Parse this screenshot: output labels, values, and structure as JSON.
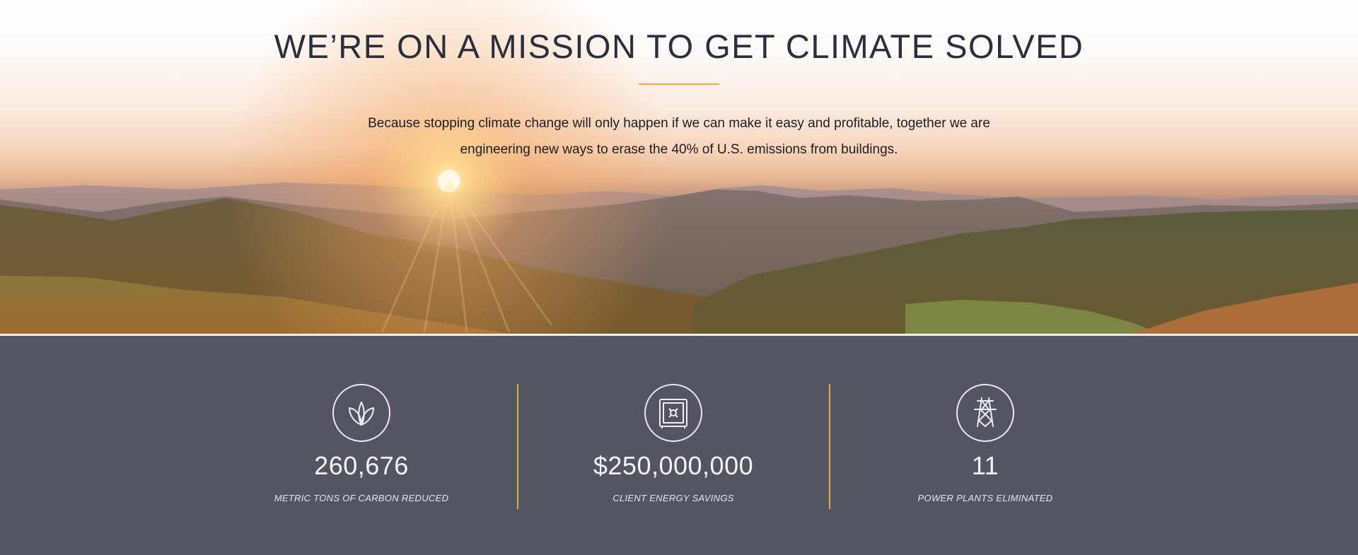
{
  "hero": {
    "title": "WE’RE ON A MISSION TO GET CLIMATE SOLVED",
    "subtitle_line1": "Because stopping climate change will only happen if we can make it easy and profitable, together we are",
    "subtitle_line2": "engineering new ways to erase the 40% of U.S. emissions from buildings.",
    "divider_color": "#e8ad3a"
  },
  "stats": {
    "background": "#535662",
    "items": [
      {
        "icon": "leaf-sprout-icon",
        "value": "260,676",
        "label": "METRIC TONS OF CARBON REDUCED"
      },
      {
        "icon": "safe-icon",
        "value": "$250,000,000",
        "label": "CLIENT ENERGY SAVINGS"
      },
      {
        "icon": "power-tower-icon",
        "value": "11",
        "label": "POWER PLANTS ELIMINATED"
      }
    ],
    "separator_color": "#e1a83b"
  }
}
